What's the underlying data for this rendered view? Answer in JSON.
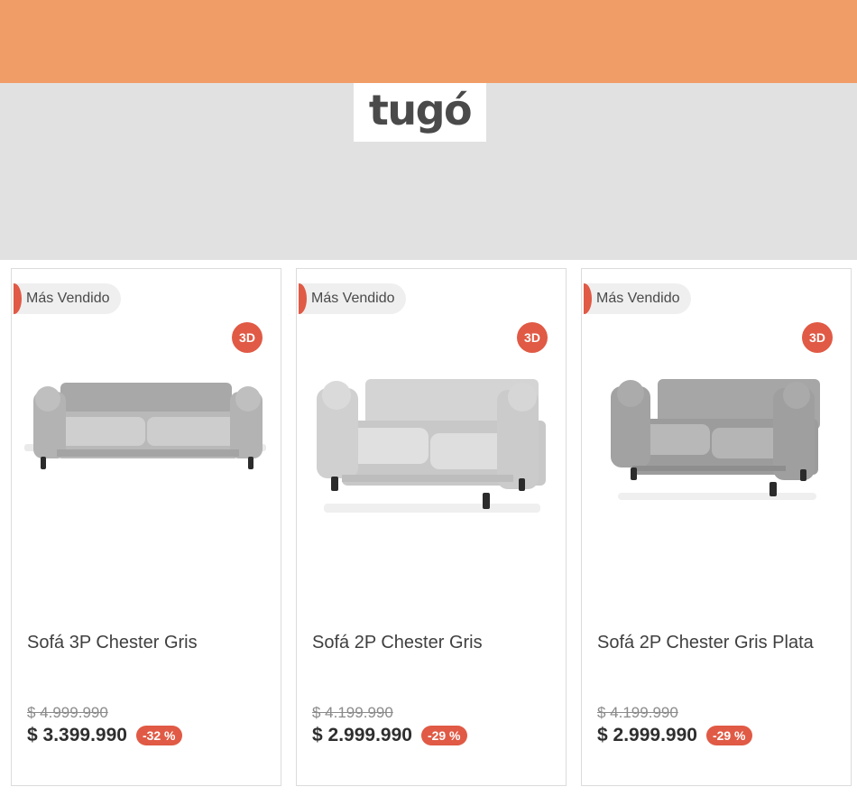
{
  "brand": {
    "logo_text": "tugó"
  },
  "products": [
    {
      "badge": "Más Vendido",
      "tag": "3D",
      "name": "Sofá 3P Chester Gris",
      "old_price": "$ 4.999.990",
      "price": "$ 3.399.990",
      "discount": "-32 %",
      "image_icon": "sofa-3p-icon",
      "color": "#bdbdbd"
    },
    {
      "badge": "Más Vendido",
      "tag": "3D",
      "name": "Sofá 2P Chester Gris",
      "old_price": "$ 4.199.990",
      "price": "$ 2.999.990",
      "discount": "-29 %",
      "image_icon": "sofa-2p-icon",
      "color": "#d2d2d2"
    },
    {
      "badge": "Más Vendido",
      "tag": "3D",
      "name": "Sofá 2P Chester Gris Plata",
      "old_price": "$ 4.199.990",
      "price": "$ 2.999.990",
      "discount": "-29 %",
      "image_icon": "sofa-2p-silver-icon",
      "color": "#a9a9a9"
    }
  ],
  "colors": {
    "header": "#f09d68",
    "hero": "#e1e1e1",
    "accent": "#e05a45"
  }
}
